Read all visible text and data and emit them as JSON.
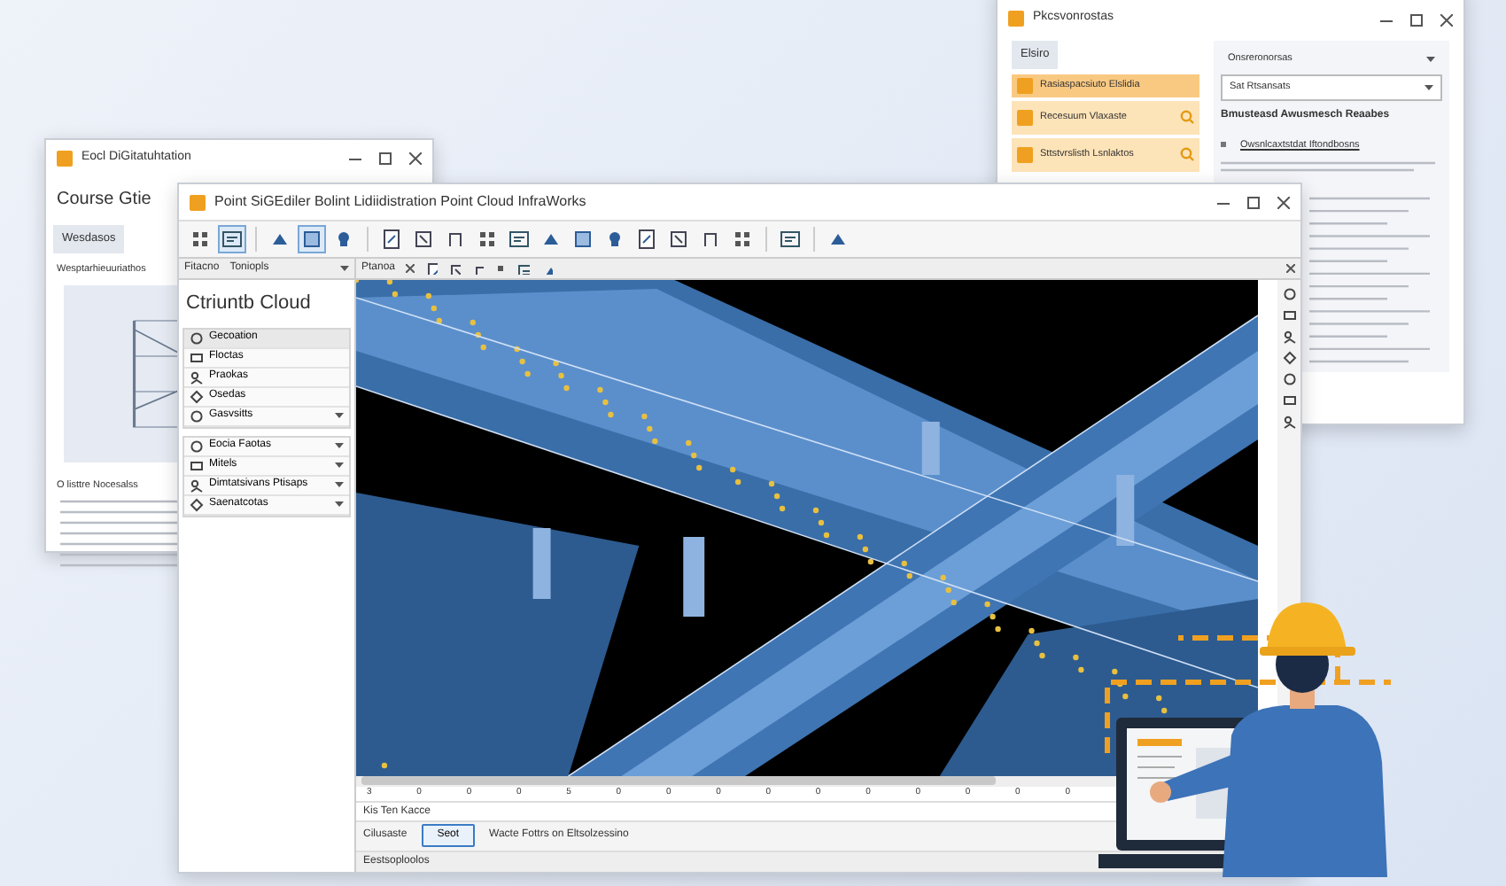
{
  "back_left_window": {
    "title": "Eocl DiGitatuhtation",
    "heading": "Course Gtie",
    "section": "Wesdasos",
    "subheading": "Wesptarhieuuriathos",
    "caption": "O listtre Nocesalss"
  },
  "back_right_window": {
    "title": "Pkcsvonrostas",
    "panel_title": "Elsiro",
    "items": [
      {
        "title": "Rasiaspacsiuto Elslidia",
        "kind": "header",
        "selected": true
      },
      {
        "title": "Recesuum Vlaxaste",
        "kind": "search",
        "selected": false
      },
      {
        "title": "Sttstvrslisth Lsnlaktos",
        "kind": "search",
        "selected": false
      }
    ],
    "dropdown": "Onsreronorsas",
    "select": "Sat Rtsansats",
    "heading": "Bmusteasd Awusmesch Reaabes",
    "link": "Owsnlcaxtstdat Iftondbosns"
  },
  "main_window": {
    "title": "Point SiGEdiler Bolint Lidiidistration Point Cloud InfraWorks",
    "panel_tabs": [
      "Fitacno",
      "Toniopls"
    ],
    "panel_heading": "Ctriuntb Cloud",
    "groups": [
      {
        "items": [
          {
            "label": "Gecoation",
            "expandable": false,
            "selected": true
          },
          {
            "label": "Floctas",
            "expandable": false,
            "selected": false
          },
          {
            "label": "Praokas",
            "expandable": false,
            "selected": false
          },
          {
            "label": "Osedas",
            "expandable": false,
            "selected": false
          },
          {
            "label": "Gasvsitts",
            "expandable": true,
            "selected": false
          }
        ]
      },
      {
        "items": [
          {
            "label": "Eocia Faotas",
            "expandable": true,
            "selected": false
          },
          {
            "label": "Mitels",
            "expandable": true,
            "selected": false
          },
          {
            "label": "Dimtatsivans Ptisaps",
            "expandable": true,
            "selected": false
          },
          {
            "label": "Saenatcotas",
            "expandable": true,
            "selected": false
          }
        ]
      }
    ],
    "view_tab": "Ptanoa",
    "ruler": [
      "3",
      "0",
      "0",
      "0",
      "5",
      "0",
      "0",
      "0",
      "0",
      "0",
      "0",
      "0",
      "0",
      "0",
      "0"
    ],
    "info_row": "Kis Ten Kacce",
    "field_label": "Cilusaste",
    "button": "Seot",
    "field_text": "Wacte Fottrs on Eltsolzessino",
    "status": "Eestsoploolos"
  }
}
